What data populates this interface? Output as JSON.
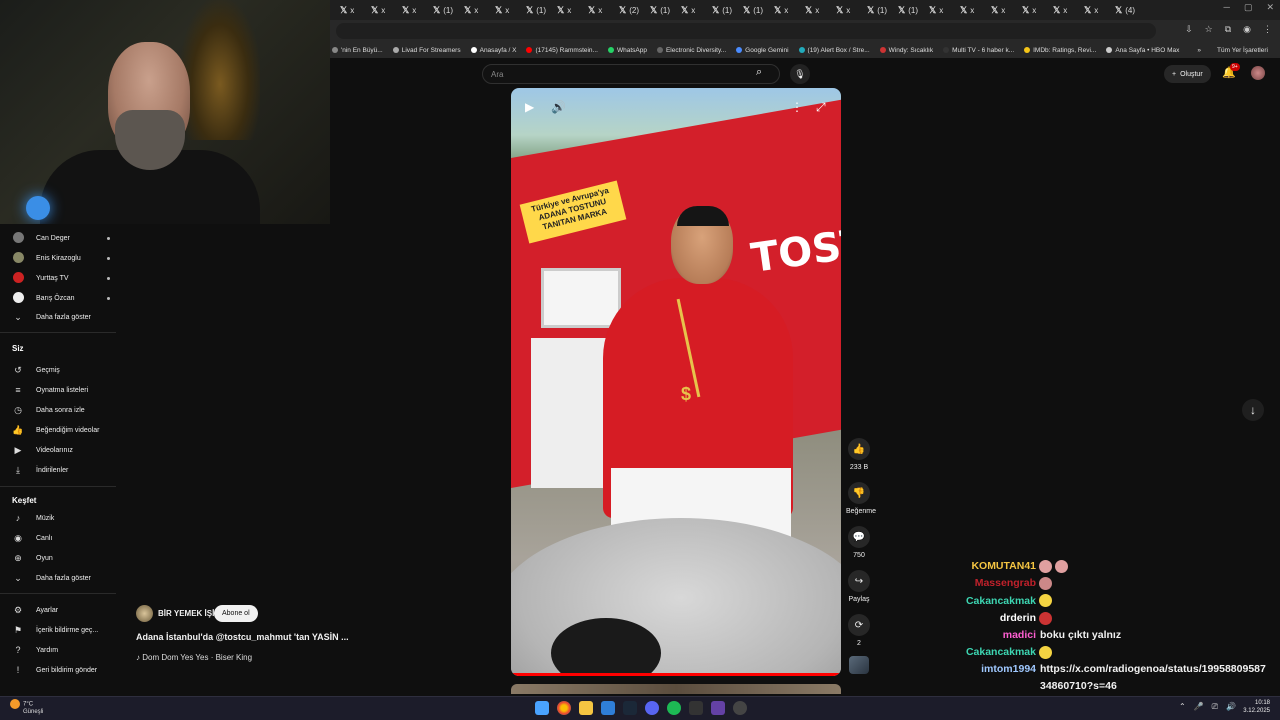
{
  "browser": {
    "tabs": [
      "x",
      "x",
      "x",
      "(1)",
      "x",
      "x",
      "(1)",
      "x",
      "x",
      "(2)",
      "(1)",
      "x",
      "(1)",
      "(1)",
      "x",
      "x",
      "x",
      "(1)",
      "(1)",
      "x",
      "x",
      "x",
      "x",
      "x",
      "x",
      "(4)"
    ],
    "bookmarks": [
      {
        "label": "'nin En Büyü...",
        "color": "#888"
      },
      {
        "label": "Livad For Streamers",
        "color": "#aaa"
      },
      {
        "label": "Anasayfa / X",
        "color": "#fff"
      },
      {
        "label": "(17145) Rammstein...",
        "color": "#f00"
      },
      {
        "label": "WhatsApp",
        "color": "#25d366"
      },
      {
        "label": "Electronic Diversity...",
        "color": "#666"
      },
      {
        "label": "Google Gemini",
        "color": "#4a8cff"
      },
      {
        "label": "(19) Alert Box / Stre...",
        "color": "#2ab"
      },
      {
        "label": "Windy: Sıcaklık",
        "color": "#c33"
      },
      {
        "label": "Multi TV - 6 haber k...",
        "color": "#333"
      },
      {
        "label": "IMDb: Ratings, Revi...",
        "color": "#f5c518"
      },
      {
        "label": "Ana Sayfa • HBO Max",
        "color": "#ccc"
      }
    ],
    "bookmarks_more": "»",
    "all_bookmarks": "Tüm Yer İşaretleri"
  },
  "header": {
    "search_placeholder": "Ara",
    "create_label": "Oluştur",
    "notif_count": "9+"
  },
  "sidebar": {
    "subscriptions": [
      {
        "label": "Can Deger",
        "color": "#777"
      },
      {
        "label": "Enis Kirazoglu",
        "color": "#886"
      },
      {
        "label": "Yurttaş TV",
        "color": "#c22"
      },
      {
        "label": "Barış Özcan",
        "color": "#eee"
      }
    ],
    "show_more": "Daha fazla göster",
    "you_heading": "Siz",
    "you_items": [
      {
        "label": "Geçmiş",
        "icon": "↺"
      },
      {
        "label": "Oynatma listeleri",
        "icon": "≡"
      },
      {
        "label": "Daha sonra izle",
        "icon": "◷"
      },
      {
        "label": "Beğendiğim videolar",
        "icon": "👍"
      },
      {
        "label": "Videolarınız",
        "icon": "▶"
      },
      {
        "label": "İndirilenler",
        "icon": "⤓"
      }
    ],
    "explore_heading": "Keşfet",
    "explore_items": [
      {
        "label": "Müzik",
        "icon": "♪"
      },
      {
        "label": "Canlı",
        "icon": "◉"
      },
      {
        "label": "Oyun",
        "icon": "⊕"
      }
    ],
    "explore_more": "Daha fazla göster",
    "bottom_items": [
      {
        "label": "Ayarlar",
        "icon": "⚙"
      },
      {
        "label": "İçerik bildirme geç...",
        "icon": "⚑"
      },
      {
        "label": "Yardım",
        "icon": "?"
      },
      {
        "label": "Geri bildirim gönder",
        "icon": "!"
      }
    ]
  },
  "short": {
    "channel": "BİR YEMEK İŞİ",
    "subscribe": "Abone ol",
    "title": "Adana İstanbul'da @tostcu_mahmut 'tan YASİN ...",
    "music": "♪ Dom Dom Yes Yes · Biser King",
    "sign_text": "Türkiye ve Avrupa'ya ADANA TOSTUNU TANITAN MARKA",
    "sign_big": "TOST",
    "progress": 1.0,
    "likes": "233 B",
    "dislike_label": "Beğenme",
    "comments": "750",
    "share_label": "Paylaş",
    "remix_count": "2"
  },
  "chat": [
    {
      "user": "KOMUTAN41",
      "color": "#f5c542",
      "msg": "",
      "emotes": [
        "#e0a0a0",
        "#e0a0a0"
      ]
    },
    {
      "user": "Massengrab",
      "color": "#c0212b",
      "msg": "",
      "emotes": [
        "#c88"
      ]
    },
    {
      "user": "Cakancakmak",
      "color": "#3dd6b2",
      "msg": "",
      "emotes": [
        "#f5d442"
      ]
    },
    {
      "user": "drderin",
      "color": "#ffffff",
      "msg": "",
      "emotes": [
        "#c33"
      ]
    },
    {
      "user": "madici",
      "color": "#ff5fd2",
      "msg": "boku çıktı yalnız",
      "emotes": []
    },
    {
      "user": "Cakancakmak",
      "color": "#3dd6b2",
      "msg": "",
      "emotes": [
        "#f5d442"
      ]
    },
    {
      "user": "imtom1994",
      "color": "#9fc8ff",
      "msg": "https://x.com/radiogenoa/status/19958809587",
      "emotes": []
    },
    {
      "user": "",
      "color": "#ffffff",
      "msg": "34860710?s=46",
      "emotes": []
    },
    {
      "user": "Cakancakmak",
      "color": "#3dd6b2",
      "msg": "",
      "emotes": [
        "#3dd6b2"
      ]
    }
  ],
  "taskbar": {
    "temp": "7°C",
    "weather": "Güneşli",
    "time": "10:18",
    "date": "3.12.2025"
  }
}
